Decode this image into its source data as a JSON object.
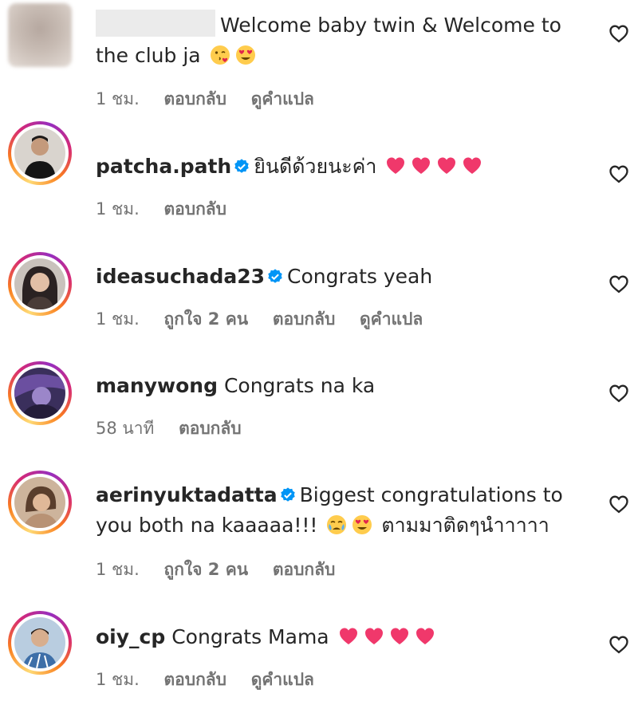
{
  "comments": [
    {
      "username": "",
      "text_before_emoji": "Welcome baby twin & Welcome to the club ja",
      "emojis": [
        "kissing-face-emoji",
        "heart-eyes-emoji"
      ],
      "time": "1 ชม.",
      "likes": "",
      "reply": "ตอบกลับ",
      "translate": "ดูคำแปล"
    },
    {
      "username": "patcha.path",
      "verified": true,
      "text": "ยินดีด้วยนะค่า",
      "emojis": [
        "heart-emoji",
        "heart-emoji",
        "heart-emoji",
        "heart-emoji"
      ],
      "time": "1 ชม.",
      "reply": "ตอบกลับ"
    },
    {
      "username": "ideasuchada23",
      "verified": true,
      "text": "Congrats yeah",
      "time": "1 ชม.",
      "likes": "ถูกใจ 2 คน",
      "reply": "ตอบกลับ",
      "translate": "ดูคำแปล"
    },
    {
      "username": "manywong",
      "verified": false,
      "text": "Congrats na ka",
      "time": "58 นาที",
      "reply": "ตอบกลับ"
    },
    {
      "username": "aerinyuktadatta",
      "verified": true,
      "text_part1": "Biggest congratulations to you both na kaaaaa!!!",
      "emojis": [
        "crying-face-emoji",
        "heart-eyes-emoji"
      ],
      "text_part2": "ตามมาติดๆนำาาาา",
      "time": "1 ชม.",
      "likes": "ถูกใจ 2 คน",
      "reply": "ตอบกลับ"
    },
    {
      "username": "oiy_cp",
      "verified": false,
      "text": "Congrats Mama",
      "emojis": [
        "heart-emoji",
        "heart-emoji",
        "heart-emoji",
        "heart-emoji"
      ],
      "time": "1 ชม.",
      "reply": "ตอบกลับ",
      "translate": "ดูคำแปล"
    }
  ],
  "colors": {
    "text": "#262626",
    "meta": "#737373",
    "verified": "#0095f6",
    "heart_emoji": "#f0386b"
  }
}
